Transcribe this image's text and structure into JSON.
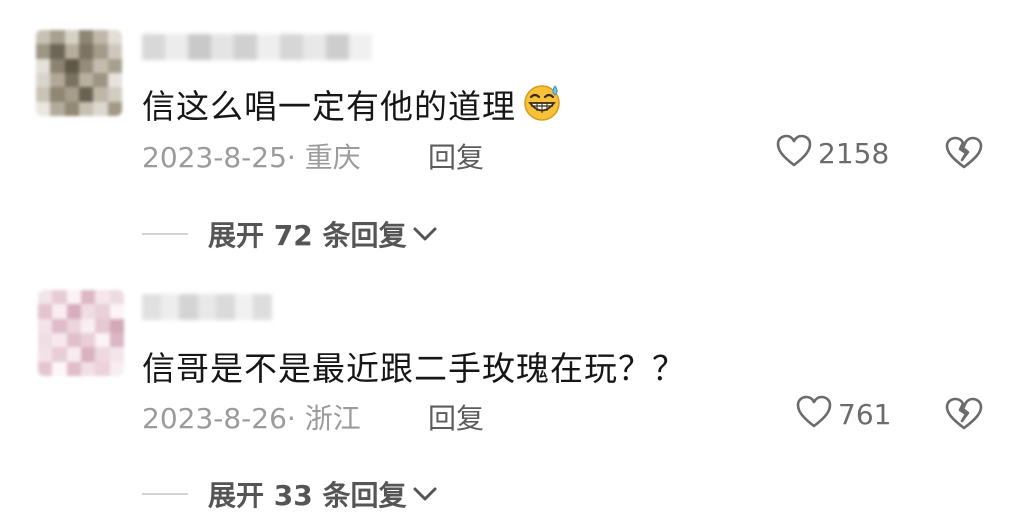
{
  "comments": [
    {
      "avatar_colors": [
        "#c8c2b6",
        "#a89f8e",
        "#d6d1c6",
        "#8c8676",
        "#bfb8a8",
        "#e2ded6",
        "#9e9684",
        "#6d6656",
        "#b7ae9c",
        "#7c7463",
        "#a49b89",
        "#cfc9bd",
        "#e4e1da",
        "#8b836f",
        "#5f5848",
        "#958c79",
        "#c3bcae",
        "#a8a08e",
        "#d9d5cc",
        "#b1a996",
        "#7a7261",
        "#b8b09e",
        "#9d9582",
        "#e6e3dc",
        "#c9c3b6",
        "#8f8774",
        "#a69e8b",
        "#6a6353",
        "#beb7a7",
        "#d2cdc2",
        "#eae7e1",
        "#b4ac9a",
        "#918975",
        "#c6c0b2",
        "#dcd8cf",
        "#a29a87"
      ],
      "username_colors": [
        "#d8d8d8",
        "#ececec",
        "#c9c9c9",
        "#e4e4e4",
        "#d0d0d0",
        "#eeeeee",
        "#d6d6d6",
        "#e8e8e8",
        "#cdcdcd",
        "#f0f0f0"
      ],
      "text": "信这么唱一定有他的道理",
      "emoji_name": "grinning-sweat-emoji",
      "date_location": "2023-8-25· 重庆",
      "reply_label": "回复",
      "likes": "2158",
      "expand_label": "展开 72 条回复"
    },
    {
      "avatar_colors": [
        "#f1e4ea",
        "#e7ccd6",
        "#fbf2f5",
        "#dcb8c5",
        "#f5e6ec",
        "#eedbe2",
        "#e3c3cf",
        "#f8edf1",
        "#d7aebd",
        "#efdde4",
        "#e9d0d9",
        "#fcf5f8",
        "#f3e3e9",
        "#dfbcc9",
        "#ecd6de",
        "#f9eff3",
        "#e5c8d2",
        "#d4a9b8",
        "#efdfe5",
        "#f6e9ee",
        "#e1bfcb",
        "#eacfd9",
        "#fbf3f6",
        "#dbb5c3",
        "#f2e2e8",
        "#e8cdd7",
        "#f7ebf0",
        "#d9b2c0",
        "#eed9e1",
        "#f4e5eb",
        "#e4c6d1",
        "#fdf7f9",
        "#e0bdca",
        "#f0e0e6",
        "#ebd2db",
        "#f8eef2"
      ],
      "username_colors": [
        "#e0e0e0",
        "#ededed",
        "#d4d4d4",
        "#e8e8e8",
        "#dadada",
        "#f1f1f1",
        "#dddddd"
      ],
      "text": "信哥是不是最近跟二手玫瑰在玩？？",
      "emoji_name": "",
      "date_location": "2023-8-26· 浙江",
      "reply_label": "回复",
      "likes": "761",
      "expand_label": "展开 33 条回复"
    }
  ]
}
